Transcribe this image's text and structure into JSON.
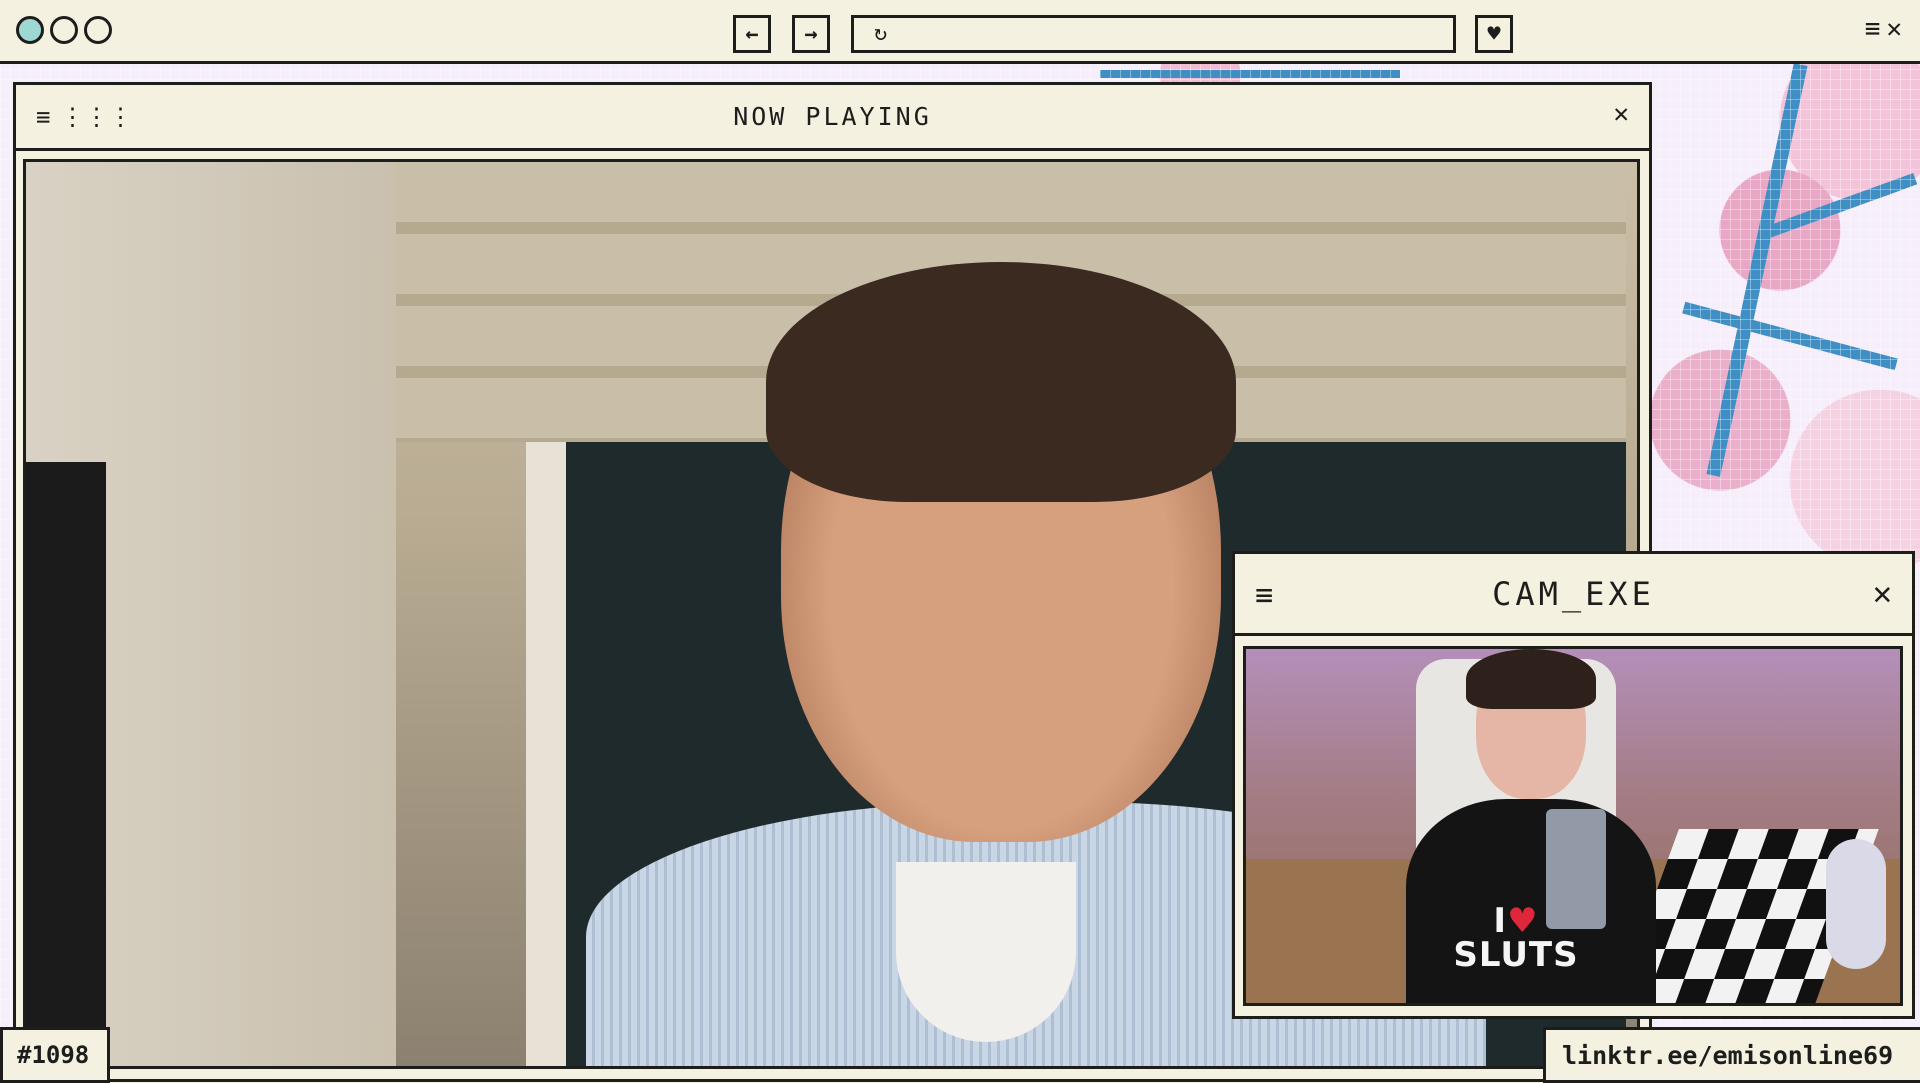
{
  "browser": {
    "back_icon": "arrow-left-icon",
    "forward_icon": "arrow-right-icon",
    "reload_icon": "reload-icon",
    "favorite_icon": "heart-icon",
    "url": "",
    "menu_icon": "menu-icon",
    "close_icon": "close-icon"
  },
  "main_window": {
    "title": "NOW PLAYING",
    "menu_icon": "menu-icon",
    "grid_icon": "grid-icon",
    "close_icon": "close-icon"
  },
  "cam_window": {
    "title": "CAM_EXE",
    "menu_icon": "menu-icon",
    "close_icon": "close-icon",
    "shirt_line1": "I",
    "shirt_line2": "SLUTS"
  },
  "labels": {
    "id_tag": "#1098",
    "link_tag": "linktr.ee/emisonline69"
  },
  "colors": {
    "frame": "#1d1d1b",
    "panel": "#f5f1e1",
    "accent_teal": "#9ed8d3",
    "blossom_pink": "#e9a7c6",
    "branch_blue": "#3f8fc4"
  }
}
